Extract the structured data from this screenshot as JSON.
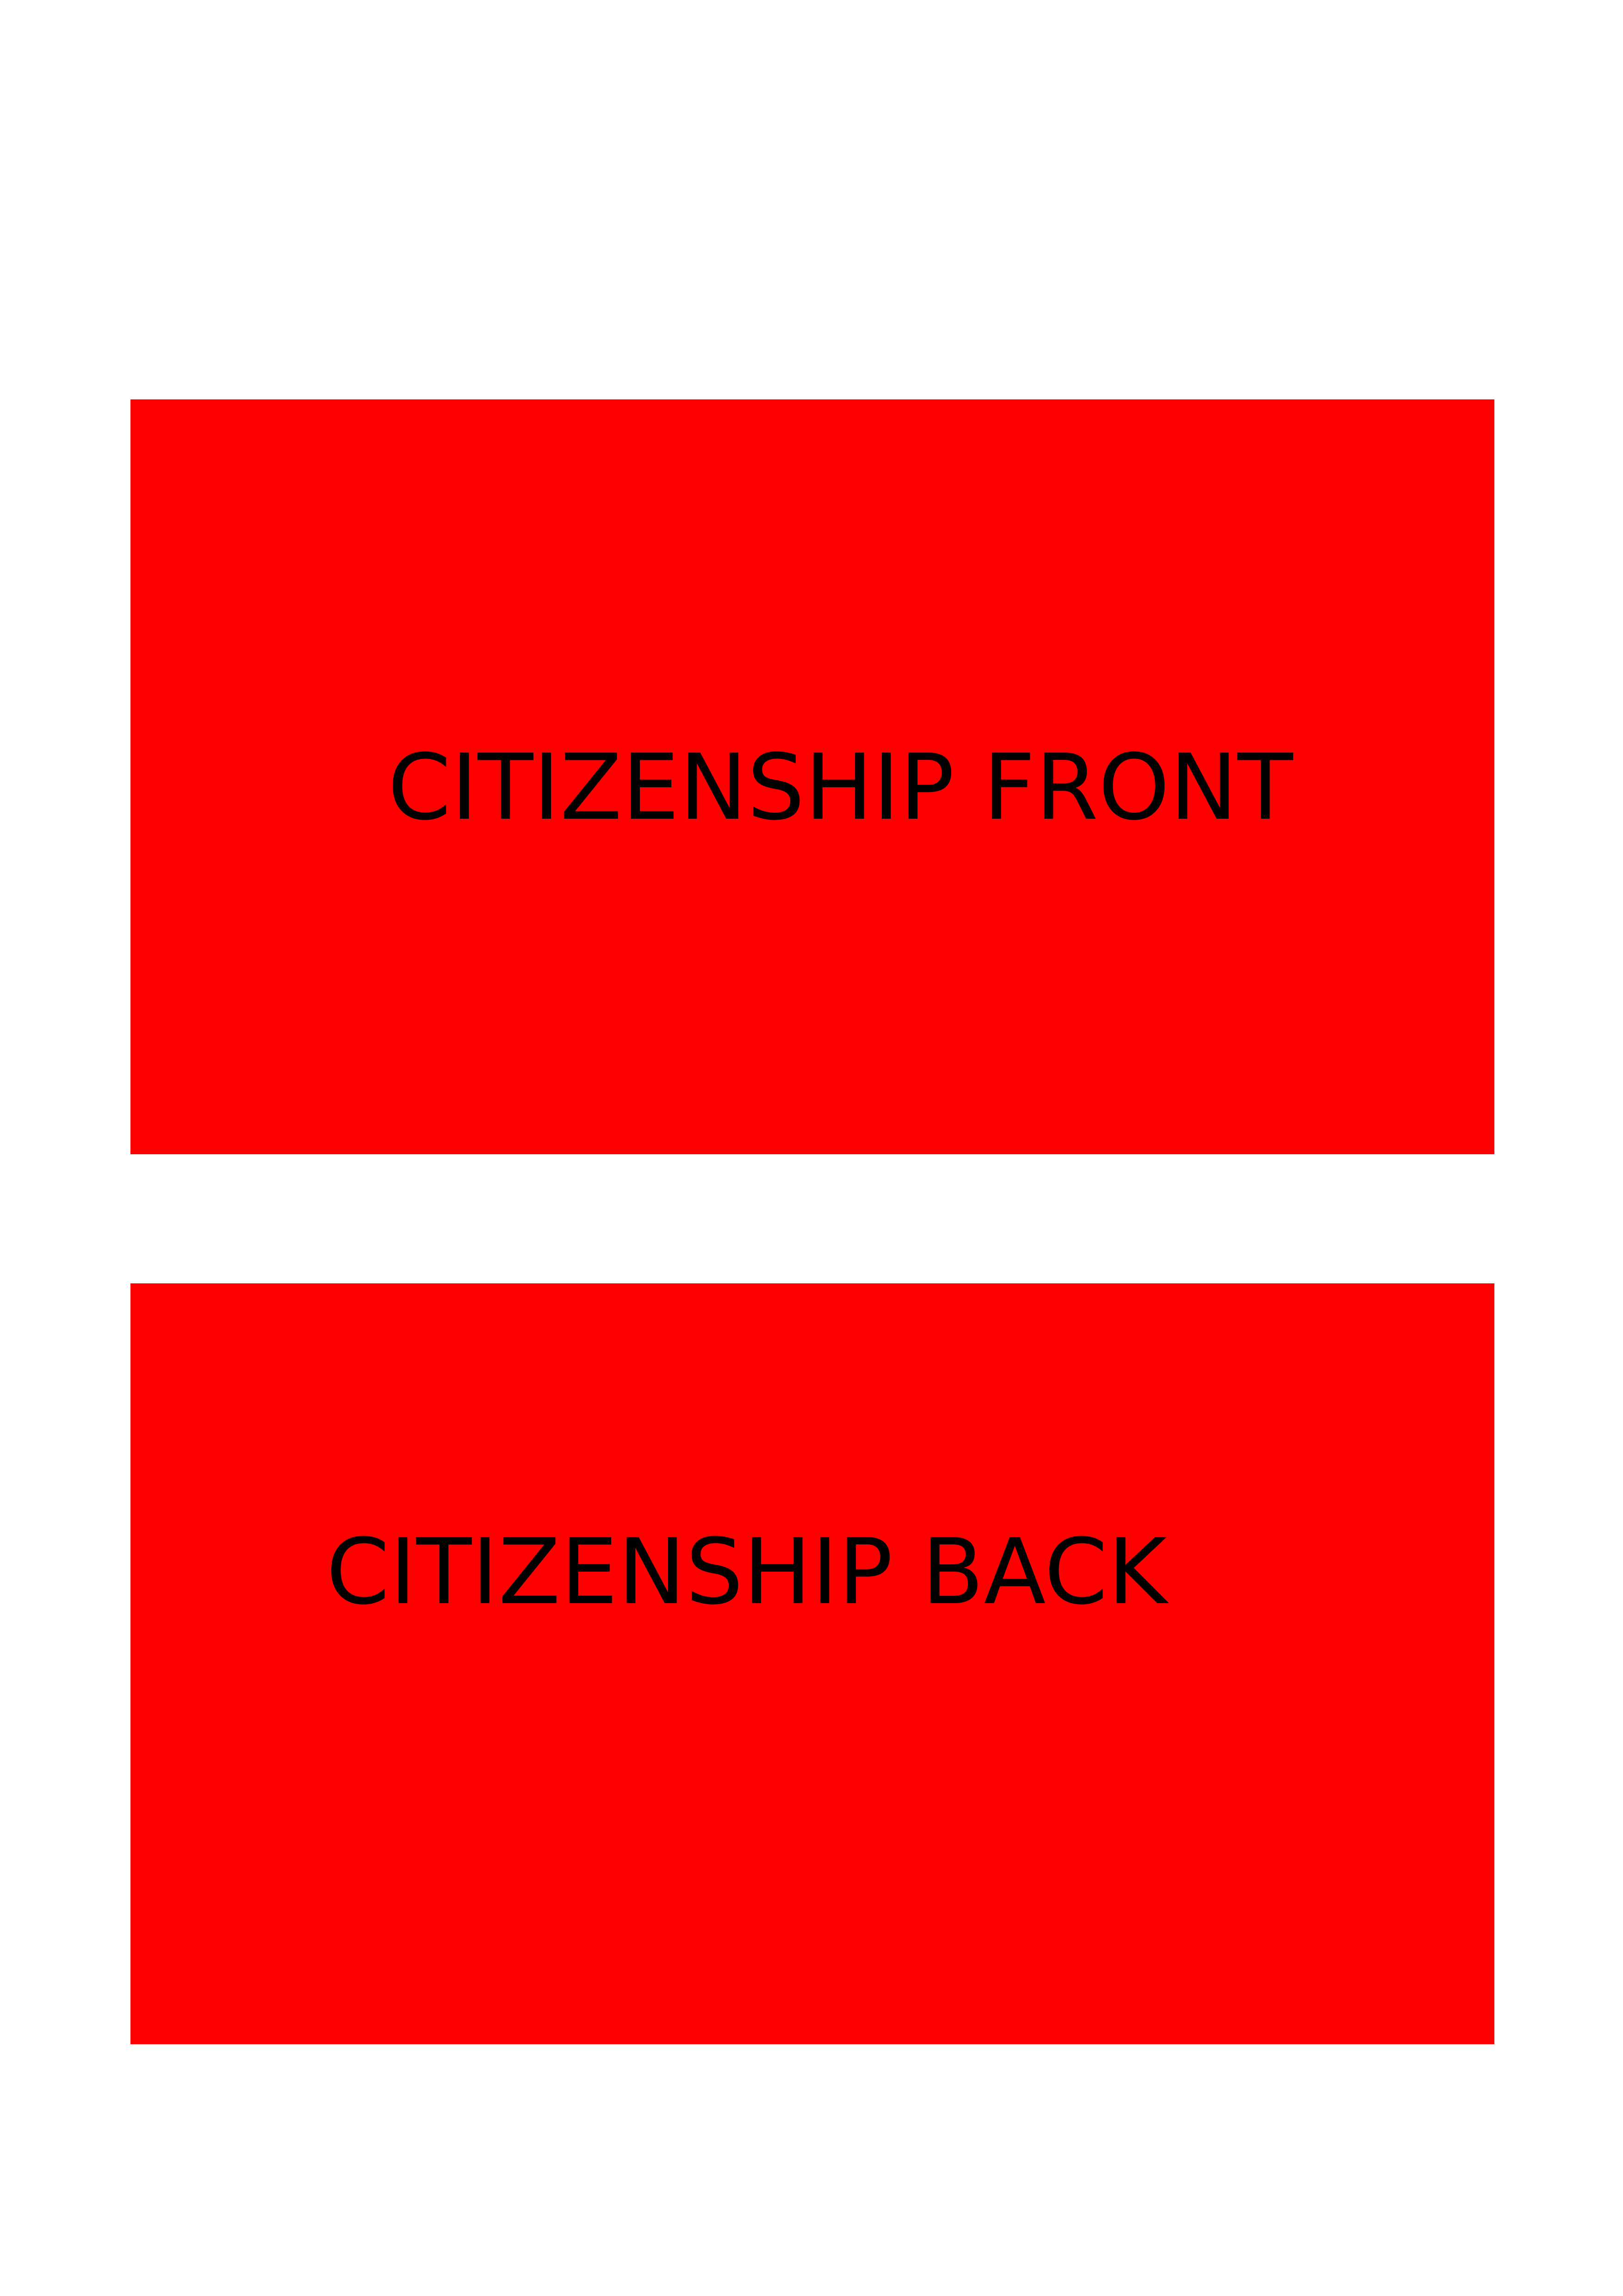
{
  "cards": {
    "front": {
      "label": "CITIZENSHIP FRONT",
      "color": "#ff0000"
    },
    "back": {
      "label": "CITIZENSHIP BACK",
      "color": "#ff0000"
    }
  },
  "colors": {
    "page_background": "#ffffff",
    "placeholder_fill": "#ff0000",
    "text": "#000000"
  }
}
